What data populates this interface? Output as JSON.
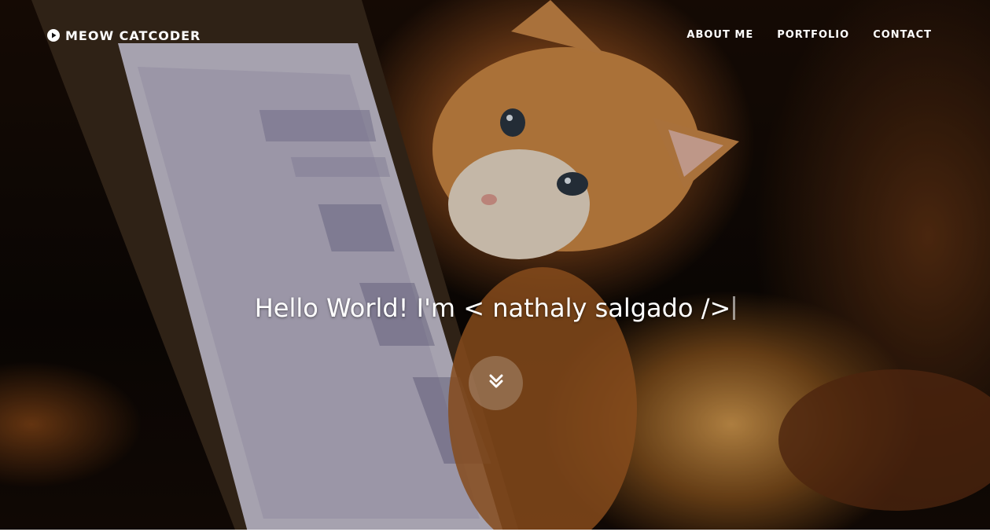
{
  "nav": {
    "brand_label": "MEOW CATCODER",
    "brand_icon": "play-circle-icon",
    "items": [
      {
        "label": "ABOUT ME"
      },
      {
        "label": "PORTFOLIO"
      },
      {
        "label": "CONTACT"
      }
    ]
  },
  "hero": {
    "headline": "Hello World! I'm < nathaly salgado />",
    "scroll_icon": "double-chevron-down-icon",
    "background_subject": "kitten-peeking-over-laptop"
  },
  "colors": {
    "text": "#ffffff",
    "background_dark": "#0c0704",
    "accent_orange": "#c97a35"
  }
}
